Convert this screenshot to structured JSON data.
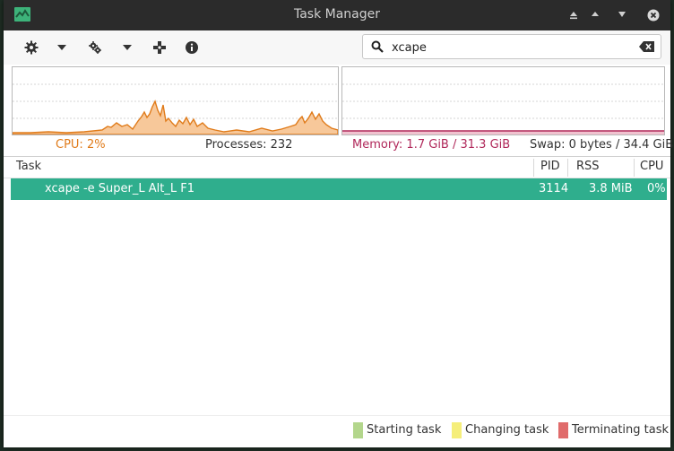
{
  "window": {
    "title": "Task Manager"
  },
  "toolbar": {
    "icons": [
      "gear-icon",
      "dropdown-icon",
      "gears-icon",
      "dropdown-icon",
      "move-icon",
      "info-icon"
    ]
  },
  "search": {
    "value": "xcape"
  },
  "stats": {
    "cpu": "CPU: 2%",
    "processes": "Processes: 232",
    "memory": "Memory: 1.7 GiB / 31.3 GiB",
    "swap": "Swap: 0 bytes / 34.4 GiB"
  },
  "columns": {
    "task": "Task",
    "pid": "PID",
    "rss": "RSS",
    "cpu": "CPU"
  },
  "tasks": [
    {
      "name": "xcape -e Super_L Alt_L F1",
      "pid": "3114",
      "rss": "3.8 MiB",
      "cpu": "0%"
    }
  ],
  "legend": {
    "starting": "Starting task",
    "changing": "Changing task",
    "terminating": "Terminating task"
  },
  "colors": {
    "cpu": "#e07b1a",
    "memory": "#b0285a",
    "selected_row": "#2fae8d",
    "starting": "#b3d68c",
    "changing": "#f5ee7a",
    "terminating": "#e06b6b"
  }
}
